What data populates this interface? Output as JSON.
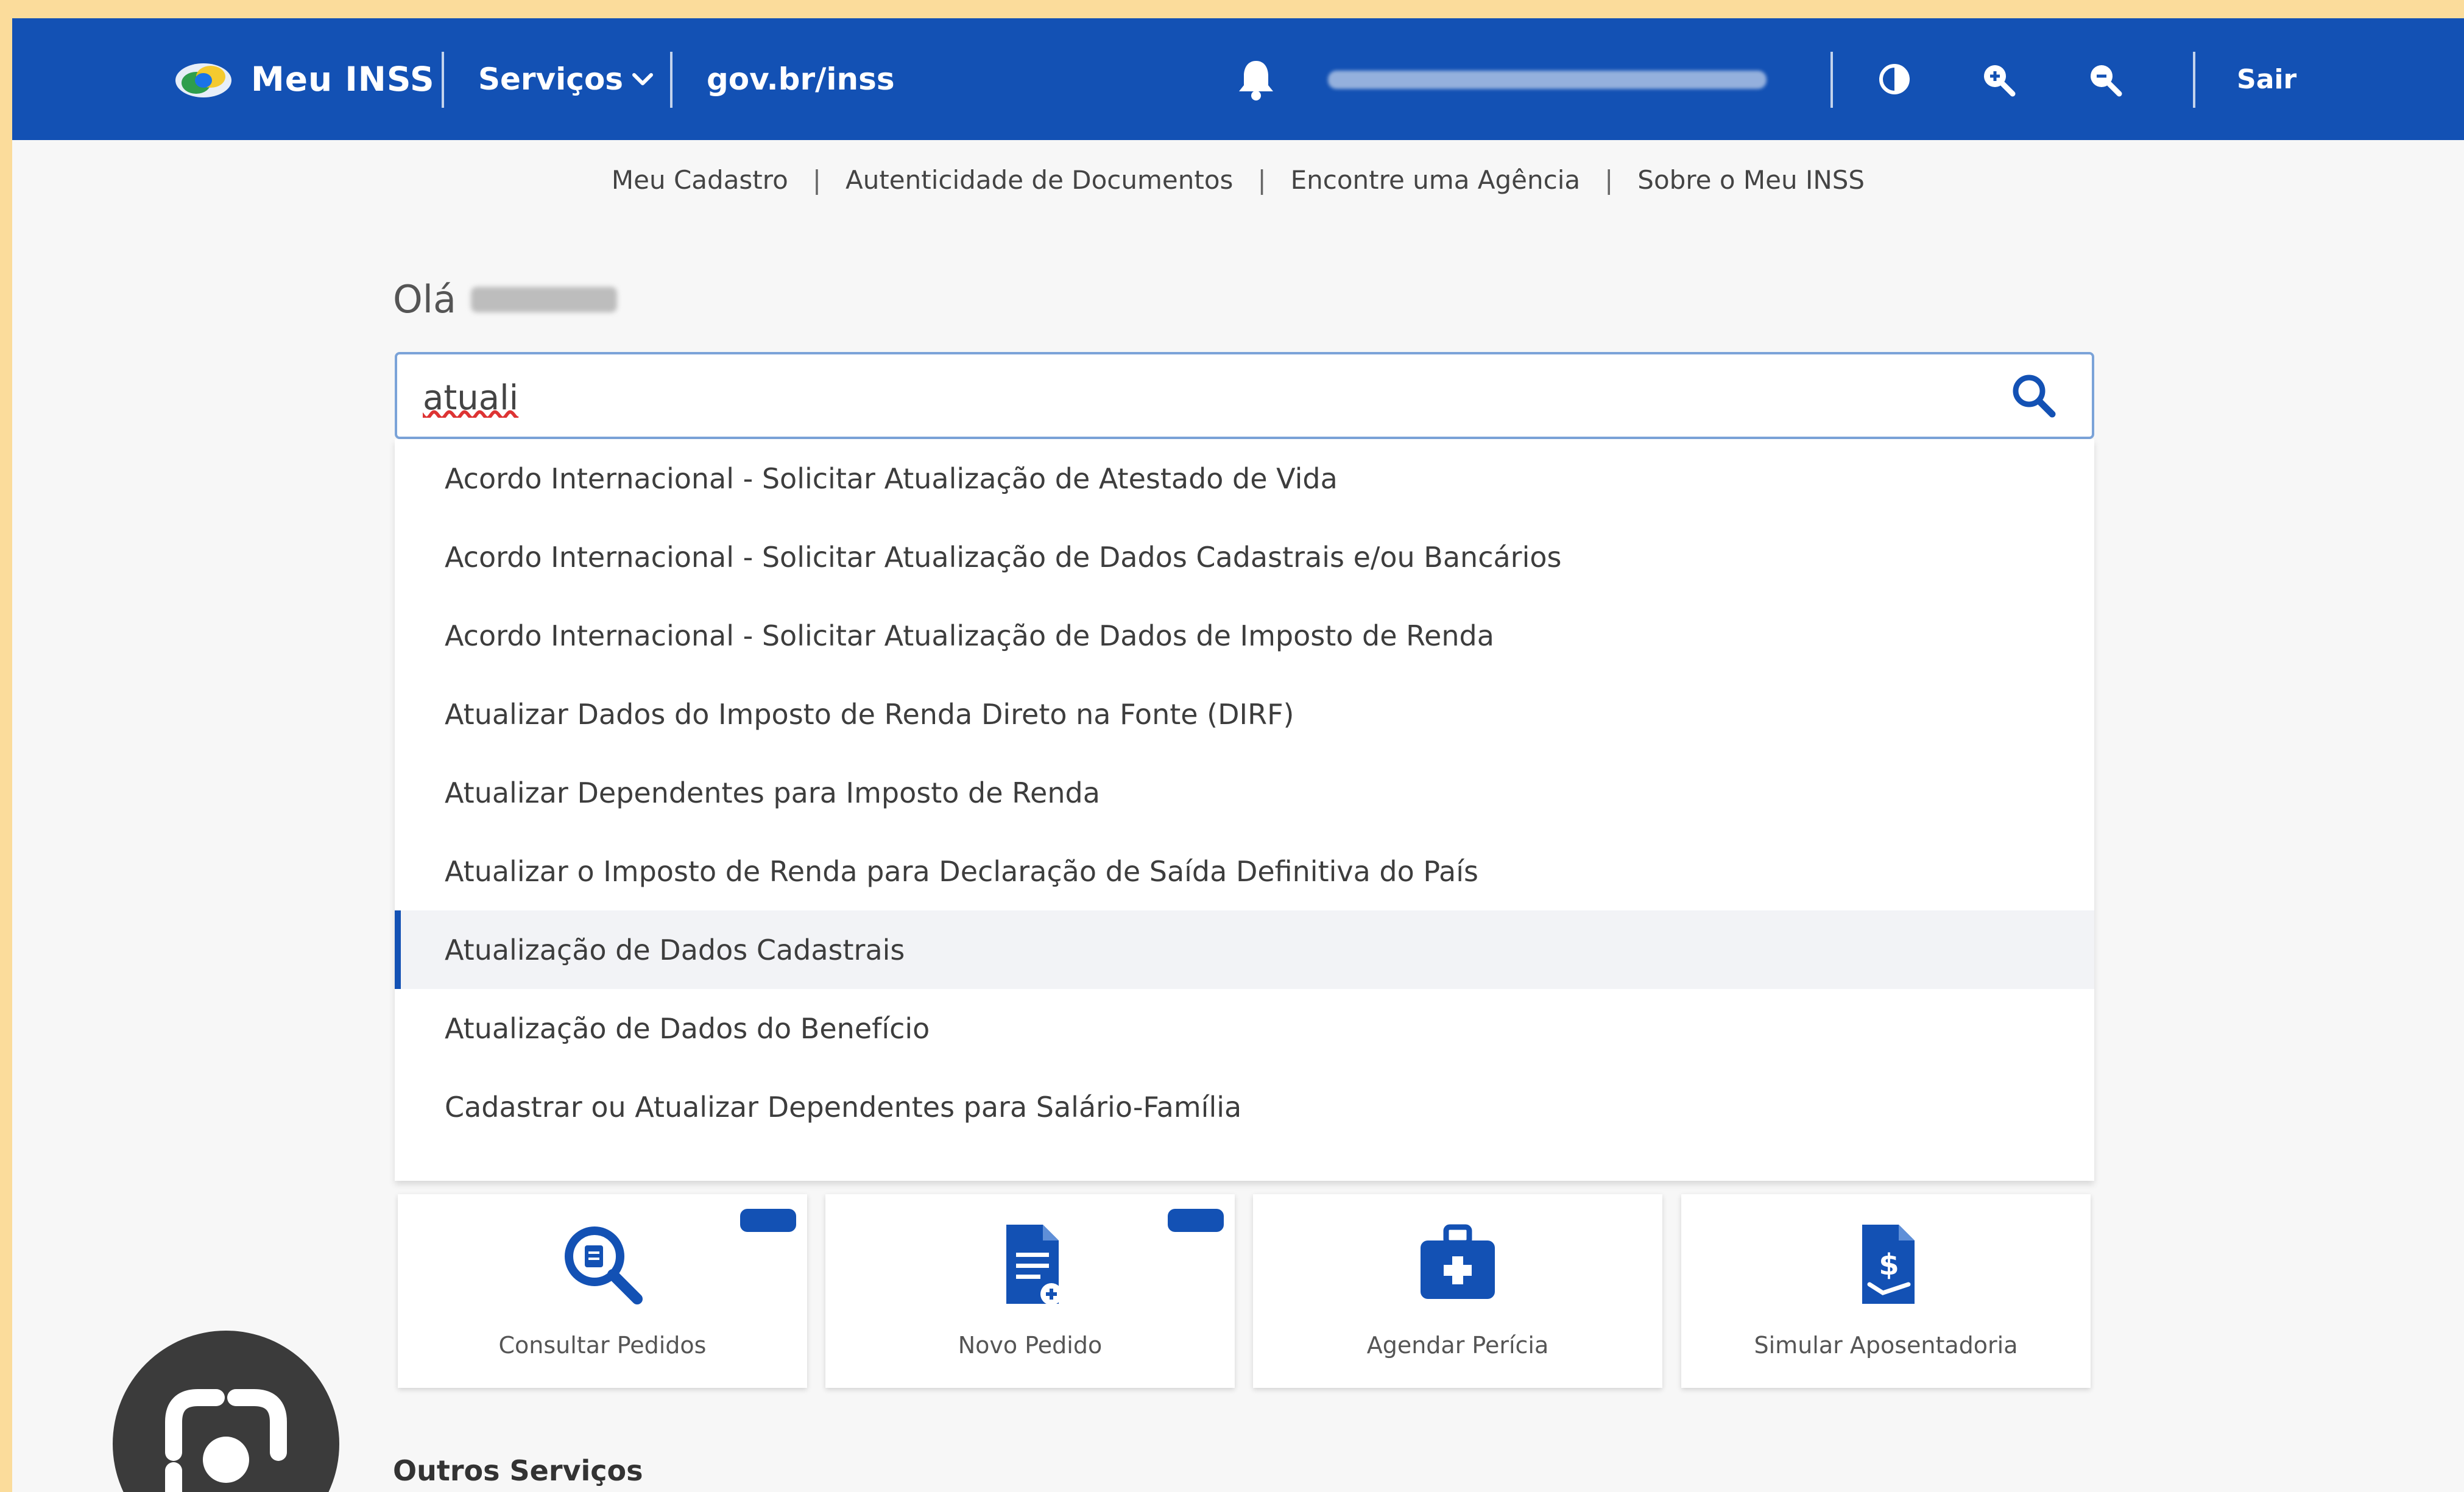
{
  "header": {
    "brand": "Meu INSS",
    "servicos": "Serviços",
    "govbr": "gov.br/inss",
    "sair": "Sair"
  },
  "subnav": {
    "items": [
      "Meu Cadastro",
      "Autenticidade de Documentos",
      "Encontre uma Agência",
      "Sobre o Meu INSS"
    ]
  },
  "greeting": "Olá",
  "search": {
    "value": "atuali"
  },
  "suggestions": [
    "Acordo Internacional - Solicitar Atualização de Atestado de Vida",
    "Acordo Internacional - Solicitar Atualização de Dados Cadastrais e/ou Bancários",
    "Acordo Internacional - Solicitar Atualização de Dados de Imposto de Renda",
    "Atualizar Dados do Imposto de Renda Direto na Fonte (DIRF)",
    "Atualizar Dependentes para Imposto de Renda",
    "Atualizar o Imposto de Renda para Declaração de Saída Definitiva do País",
    "Atualização de Dados Cadastrais",
    "Atualização de Dados do Benefício",
    "Cadastrar ou Atualizar Dependentes para Salário-Família"
  ],
  "active_suggestion_index": 6,
  "cards": [
    {
      "label": "Consultar Pedidos",
      "icon": "search-document-icon",
      "badge": true
    },
    {
      "label": "Novo Pedido",
      "icon": "new-document-icon",
      "badge": true
    },
    {
      "label": "Agendar Perícia",
      "icon": "medical-kit-icon",
      "badge": false
    },
    {
      "label": "Simular Aposentadoria",
      "icon": "document-money-icon",
      "badge": false
    }
  ],
  "outros_servicos": "Outros Serviços",
  "colors": {
    "header_blue": "#1351b4",
    "page_bg": "#f7f7f7",
    "frame": "#fbdc9b"
  }
}
